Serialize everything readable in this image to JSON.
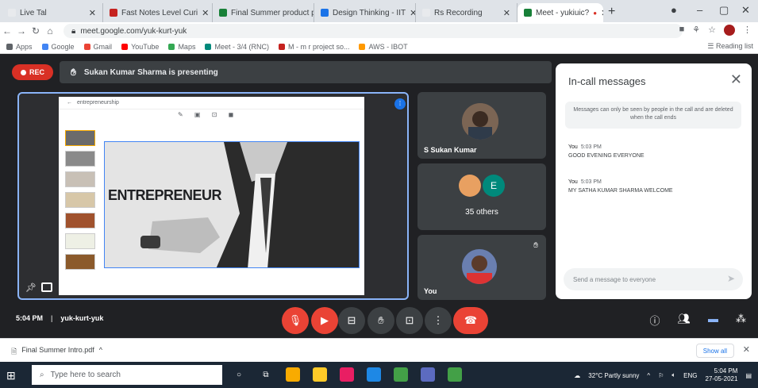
{
  "browser": {
    "tabs": [
      {
        "label": "Live Tal",
        "color": "#e8eaed"
      },
      {
        "label": "Fast Notes Level Curi",
        "color": "#c5221f"
      },
      {
        "label": "Final Summer product pl",
        "color": "#188038"
      },
      {
        "label": "Design Thinking - IIT",
        "color": "#1a73e8"
      },
      {
        "label": "Rs Recording",
        "color": "#e8eaed"
      },
      {
        "label": "Meet - yukiuic?",
        "color": "#188038"
      }
    ],
    "address": "meet.google.com/yuk-kurt-yuk",
    "bookmarks": [
      "Apps",
      "Google",
      "Gmail",
      "YouTube",
      "Maps",
      "Meet - 3/4 (RNC)",
      "M - m r project so...",
      "AWS - IBOT"
    ],
    "reading_list": "Reading list"
  },
  "meet": {
    "rec_label": "REC",
    "presenting_banner": "Sukan Kumar Sharma is presenting",
    "slide": {
      "app_title": "entrepreneurship",
      "headline": "ENTREPRENEUR"
    },
    "participants": [
      {
        "name": "S Sukan Kumar"
      },
      {
        "name": "35 others"
      },
      {
        "name": "You"
      }
    ],
    "chat": {
      "title": "In-call messages",
      "notice": "Messages can only be seen by people in the call and are deleted when the call ends",
      "messages": [
        {
          "sender": "You",
          "time": "5:03 PM",
          "text": "GOOD EVENING EVERYONE"
        },
        {
          "sender": "You",
          "time": "5:03 PM",
          "text": "MY SATHA KUMAR SHARMA WELCOME"
        }
      ],
      "input_placeholder": "Send a message to everyone"
    },
    "controls": {
      "time": "5:04 PM",
      "meeting_code": "yuk-kurt-yuk"
    }
  },
  "downloads": {
    "file": "Final Summer Intro.pdf",
    "show_all": "Show all"
  },
  "taskbar": {
    "search_placeholder": "Type here to search",
    "weather": "32°C Partly sunny",
    "lang": "ENG",
    "time": "5:04 PM",
    "date": "27-05-2021"
  }
}
